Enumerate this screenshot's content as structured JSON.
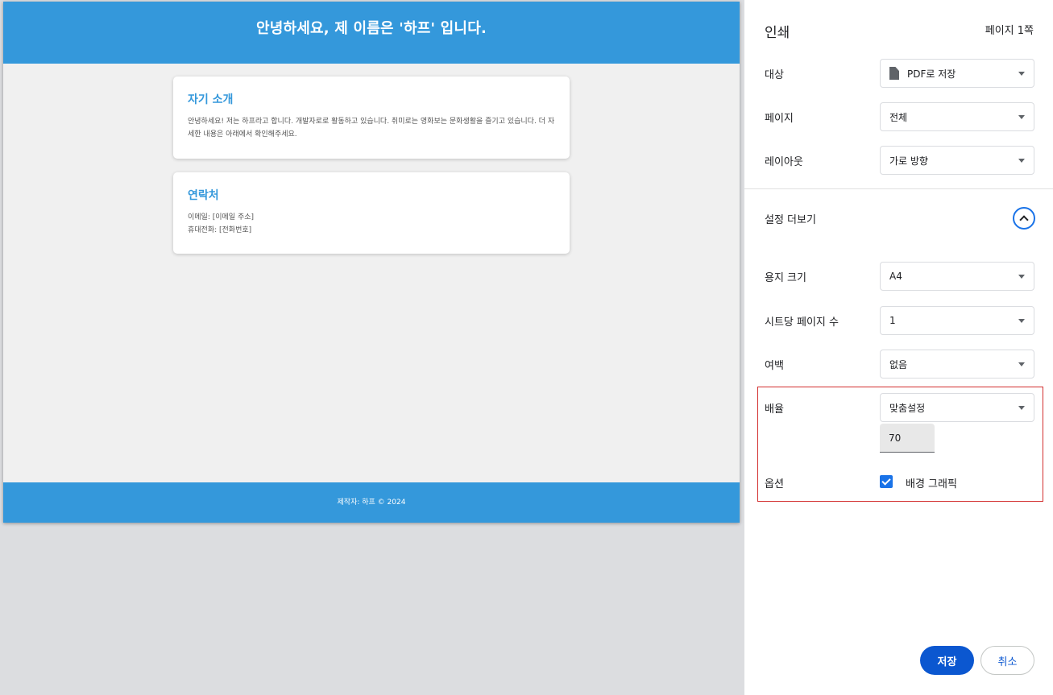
{
  "preview": {
    "header_title": "안녕하세요, 제 이름은 '하프' 입니다.",
    "intro": {
      "title": "자기 소개",
      "text": "안녕하세요! 저는 하프라고 합니다. 개발자로로 활동하고 있습니다. 취미로는 영화보는 문화생활을 즐기고 있습니다. 더 자세한 내용은 아래에서 확인해주세요."
    },
    "contact": {
      "title": "연락처",
      "email": "이메일: [이메일 주소]",
      "phone": "휴대전화: [전화번호]"
    },
    "footer": "제작자: 하프 © 2024"
  },
  "panel": {
    "title": "인쇄",
    "page_count": "페이지 1쪽",
    "destination": {
      "label": "대상",
      "value": "PDF로 저장"
    },
    "pages": {
      "label": "페이지",
      "value": "전체"
    },
    "layout": {
      "label": "레이아웃",
      "value": "가로 방향"
    },
    "more_settings": "설정 더보기",
    "paper_size": {
      "label": "용지 크기",
      "value": "A4"
    },
    "pages_per_sheet": {
      "label": "시트당 페이지 수",
      "value": "1"
    },
    "margins": {
      "label": "여백",
      "value": "없음"
    },
    "scale": {
      "label": "배율",
      "value": "맞춤설정",
      "custom_value": "70"
    },
    "options": {
      "label": "옵션",
      "background_graphics": "배경 그래픽",
      "background_graphics_checked": true
    },
    "save_button": "저장",
    "cancel_button": "취소"
  },
  "colors": {
    "preview_header": "#3498db",
    "accent": "#1a73e8",
    "save_button": "#0b57d0",
    "highlight_border": "#d32f2f"
  },
  "icons": [
    "file-icon",
    "chevron-up-icon",
    "checkmark-icon",
    "caret-down-icon"
  ]
}
